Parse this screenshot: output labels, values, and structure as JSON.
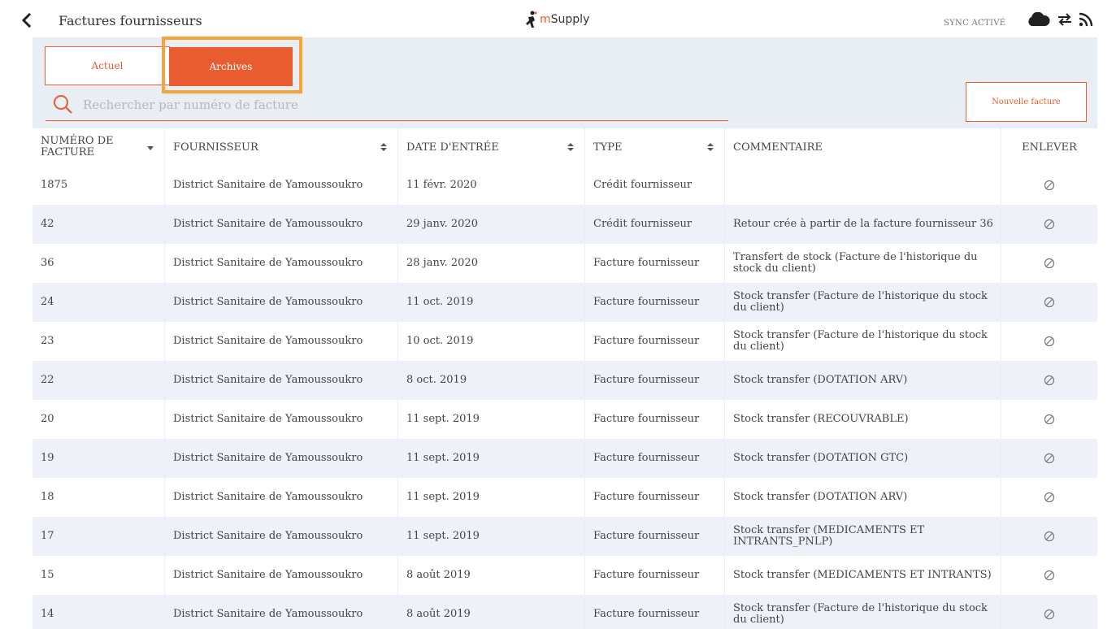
{
  "header": {
    "title": "Factures fournisseurs",
    "logo_m": "m",
    "logo_rest": "Supply",
    "sync_label": "SYNC ACTIVÉ"
  },
  "tabs": {
    "current": "Actuel",
    "archive": "Archives"
  },
  "search": {
    "placeholder": "Rechercher par numéro de facture",
    "value": ""
  },
  "new_invoice_button": "Nouvelle facture",
  "accent_color": "#e95c30",
  "highlight_color": "#f6a43a",
  "table": {
    "columns": [
      "NUMÉRO DE FACTURE",
      "FOURNISSEUR",
      "DATE D'ENTRÉE",
      "TYPE",
      "COMMENTAIRE",
      "ENLEVER"
    ],
    "rows": [
      {
        "number": "1875",
        "supplier": "District Sanitaire de Yamoussoukro",
        "date": "11 févr. 2020",
        "type": "Crédit fournisseur",
        "comment": ""
      },
      {
        "number": "42",
        "supplier": "District Sanitaire de Yamoussoukro",
        "date": "29 janv. 2020",
        "type": "Crédit fournisseur",
        "comment": "Retour crée à partir de la facture fournisseur 36"
      },
      {
        "number": "36",
        "supplier": "District Sanitaire de Yamoussoukro",
        "date": "28 janv. 2020",
        "type": "Facture fournisseur",
        "comment": "Transfert de stock (Facture de l'historique du stock du client)"
      },
      {
        "number": "24",
        "supplier": "District Sanitaire de Yamoussoukro",
        "date": "11 oct. 2019",
        "type": "Facture fournisseur",
        "comment": "Stock transfer (Facture de l'historique du stock du client)"
      },
      {
        "number": "23",
        "supplier": "District Sanitaire de Yamoussoukro",
        "date": "10 oct. 2019",
        "type": "Facture fournisseur",
        "comment": "Stock transfer (Facture de l'historique du stock du client)"
      },
      {
        "number": "22",
        "supplier": "District Sanitaire de Yamoussoukro",
        "date": "8 oct. 2019",
        "type": "Facture fournisseur",
        "comment": "Stock transfer (DOTATION ARV)"
      },
      {
        "number": "20",
        "supplier": "District Sanitaire de Yamoussoukro",
        "date": "11 sept. 2019",
        "type": "Facture fournisseur",
        "comment": "Stock transfer (RECOUVRABLE)"
      },
      {
        "number": "19",
        "supplier": "District Sanitaire de Yamoussoukro",
        "date": "11 sept. 2019",
        "type": "Facture fournisseur",
        "comment": "Stock transfer (DOTATION GTC)"
      },
      {
        "number": "18",
        "supplier": "District Sanitaire de Yamoussoukro",
        "date": "11 sept. 2019",
        "type": "Facture fournisseur",
        "comment": "Stock transfer (DOTATION ARV)"
      },
      {
        "number": "17",
        "supplier": "District Sanitaire de Yamoussoukro",
        "date": "11 sept. 2019",
        "type": "Facture fournisseur",
        "comment": "Stock transfer (MEDICAMENTS ET INTRANTS_PNLP)"
      },
      {
        "number": "15",
        "supplier": "District Sanitaire de Yamoussoukro",
        "date": "8 août 2019",
        "type": "Facture fournisseur",
        "comment": "Stock transfer (MEDICAMENTS ET INTRANTS)"
      },
      {
        "number": "14",
        "supplier": "District Sanitaire de Yamoussoukro",
        "date": "8 août 2019",
        "type": "Facture fournisseur",
        "comment": "Stock transfer (Facture de l'historique du stock du client)"
      }
    ]
  }
}
